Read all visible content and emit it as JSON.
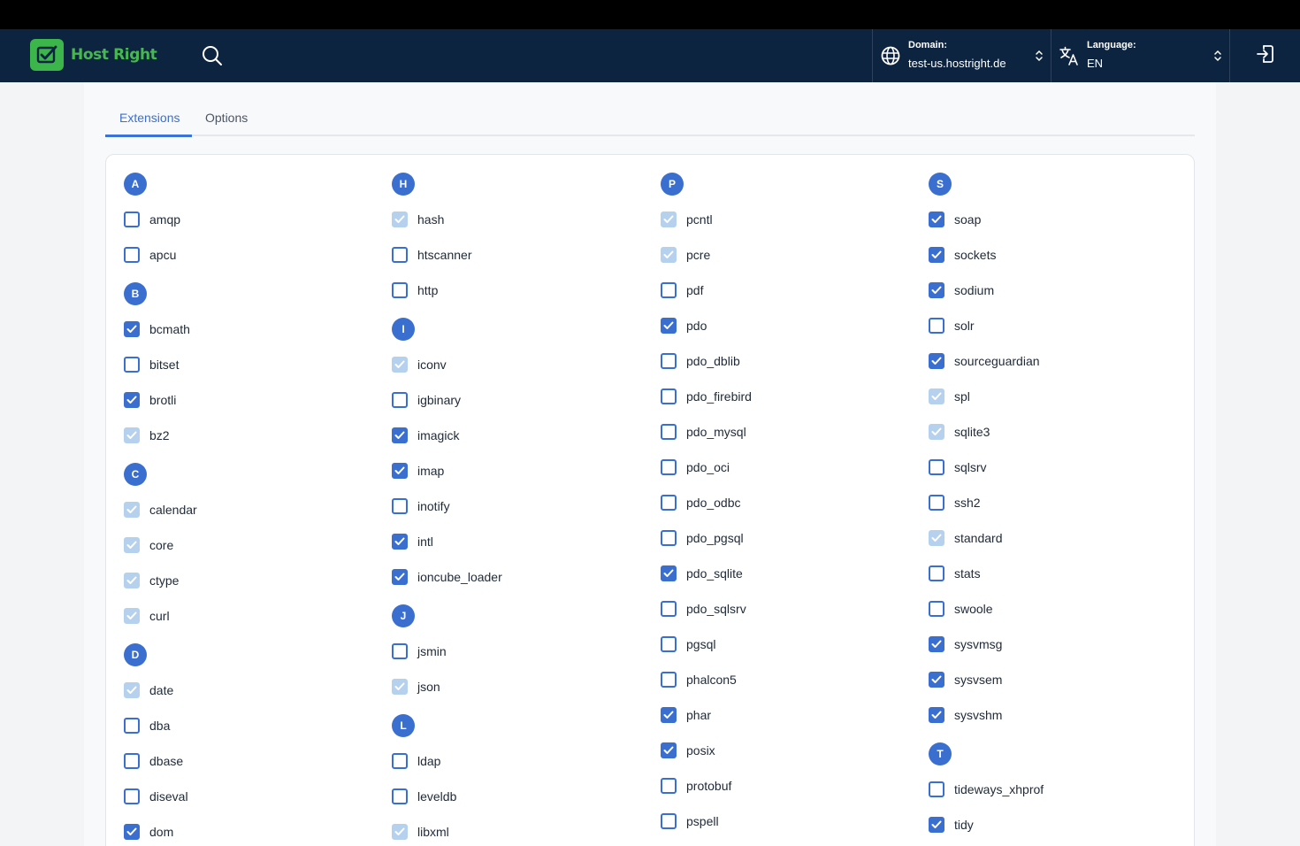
{
  "app": {
    "name": "Host Right"
  },
  "header": {
    "domain": {
      "label": "Domain:",
      "value": "test-us.hostright.de"
    },
    "language": {
      "label": "Language:",
      "value": "EN"
    }
  },
  "tabs": [
    {
      "label": "Extensions",
      "active": true
    },
    {
      "label": "Options",
      "active": false
    }
  ],
  "colors": {
    "accent": "#3b6fcf",
    "header_bg": "#0d2440",
    "brand_green": "#3cb54a",
    "disabled_check": "#b6d1ee"
  },
  "icons": [
    "logo-check-icon",
    "search-icon",
    "globe-icon",
    "translate-icon",
    "chevron-updown-icon",
    "logout-icon",
    "checkmark-icon"
  ],
  "columns": [
    {
      "groups": [
        {
          "letter": "A",
          "items": [
            {
              "name": "amqp",
              "state": "off"
            },
            {
              "name": "apcu",
              "state": "off"
            }
          ]
        },
        {
          "letter": "B",
          "items": [
            {
              "name": "bcmath",
              "state": "on"
            },
            {
              "name": "bitset",
              "state": "off"
            },
            {
              "name": "brotli",
              "state": "on"
            },
            {
              "name": "bz2",
              "state": "disabled"
            }
          ]
        },
        {
          "letter": "C",
          "items": [
            {
              "name": "calendar",
              "state": "disabled"
            },
            {
              "name": "core",
              "state": "disabled"
            },
            {
              "name": "ctype",
              "state": "disabled"
            },
            {
              "name": "curl",
              "state": "disabled"
            }
          ]
        },
        {
          "letter": "D",
          "items": [
            {
              "name": "date",
              "state": "disabled"
            },
            {
              "name": "dba",
              "state": "off"
            },
            {
              "name": "dbase",
              "state": "off"
            },
            {
              "name": "diseval",
              "state": "off"
            },
            {
              "name": "dom",
              "state": "on"
            }
          ]
        }
      ]
    },
    {
      "groups": [
        {
          "letter": "H",
          "items": [
            {
              "name": "hash",
              "state": "disabled"
            },
            {
              "name": "htscanner",
              "state": "off"
            },
            {
              "name": "http",
              "state": "off"
            }
          ]
        },
        {
          "letter": "I",
          "items": [
            {
              "name": "iconv",
              "state": "disabled"
            },
            {
              "name": "igbinary",
              "state": "off"
            },
            {
              "name": "imagick",
              "state": "on"
            },
            {
              "name": "imap",
              "state": "on"
            },
            {
              "name": "inotify",
              "state": "off"
            },
            {
              "name": "intl",
              "state": "on"
            },
            {
              "name": "ioncube_loader",
              "state": "on"
            }
          ]
        },
        {
          "letter": "J",
          "items": [
            {
              "name": "jsmin",
              "state": "off"
            },
            {
              "name": "json",
              "state": "disabled"
            }
          ]
        },
        {
          "letter": "L",
          "items": [
            {
              "name": "ldap",
              "state": "off"
            },
            {
              "name": "leveldb",
              "state": "off"
            },
            {
              "name": "libxml",
              "state": "disabled"
            }
          ]
        }
      ]
    },
    {
      "groups": [
        {
          "letter": "P",
          "items": [
            {
              "name": "pcntl",
              "state": "disabled"
            },
            {
              "name": "pcre",
              "state": "disabled"
            },
            {
              "name": "pdf",
              "state": "off"
            },
            {
              "name": "pdo",
              "state": "on"
            },
            {
              "name": "pdo_dblib",
              "state": "off"
            },
            {
              "name": "pdo_firebird",
              "state": "off"
            },
            {
              "name": "pdo_mysql",
              "state": "off"
            },
            {
              "name": "pdo_oci",
              "state": "off"
            },
            {
              "name": "pdo_odbc",
              "state": "off"
            },
            {
              "name": "pdo_pgsql",
              "state": "off"
            },
            {
              "name": "pdo_sqlite",
              "state": "on"
            },
            {
              "name": "pdo_sqlsrv",
              "state": "off"
            },
            {
              "name": "pgsql",
              "state": "off"
            },
            {
              "name": "phalcon5",
              "state": "off"
            },
            {
              "name": "phar",
              "state": "on"
            },
            {
              "name": "posix",
              "state": "on"
            },
            {
              "name": "protobuf",
              "state": "off"
            },
            {
              "name": "pspell",
              "state": "off"
            }
          ]
        }
      ]
    },
    {
      "groups": [
        {
          "letter": "S",
          "items": [
            {
              "name": "soap",
              "state": "on"
            },
            {
              "name": "sockets",
              "state": "on"
            },
            {
              "name": "sodium",
              "state": "on"
            },
            {
              "name": "solr",
              "state": "off"
            },
            {
              "name": "sourceguardian",
              "state": "on"
            },
            {
              "name": "spl",
              "state": "disabled"
            },
            {
              "name": "sqlite3",
              "state": "disabled"
            },
            {
              "name": "sqlsrv",
              "state": "off"
            },
            {
              "name": "ssh2",
              "state": "off"
            },
            {
              "name": "standard",
              "state": "disabled"
            },
            {
              "name": "stats",
              "state": "off"
            },
            {
              "name": "swoole",
              "state": "off"
            },
            {
              "name": "sysvmsg",
              "state": "on"
            },
            {
              "name": "sysvsem",
              "state": "on"
            },
            {
              "name": "sysvshm",
              "state": "on"
            }
          ]
        },
        {
          "letter": "T",
          "items": [
            {
              "name": "tideways_xhprof",
              "state": "off"
            },
            {
              "name": "tidy",
              "state": "on"
            }
          ]
        }
      ]
    }
  ]
}
